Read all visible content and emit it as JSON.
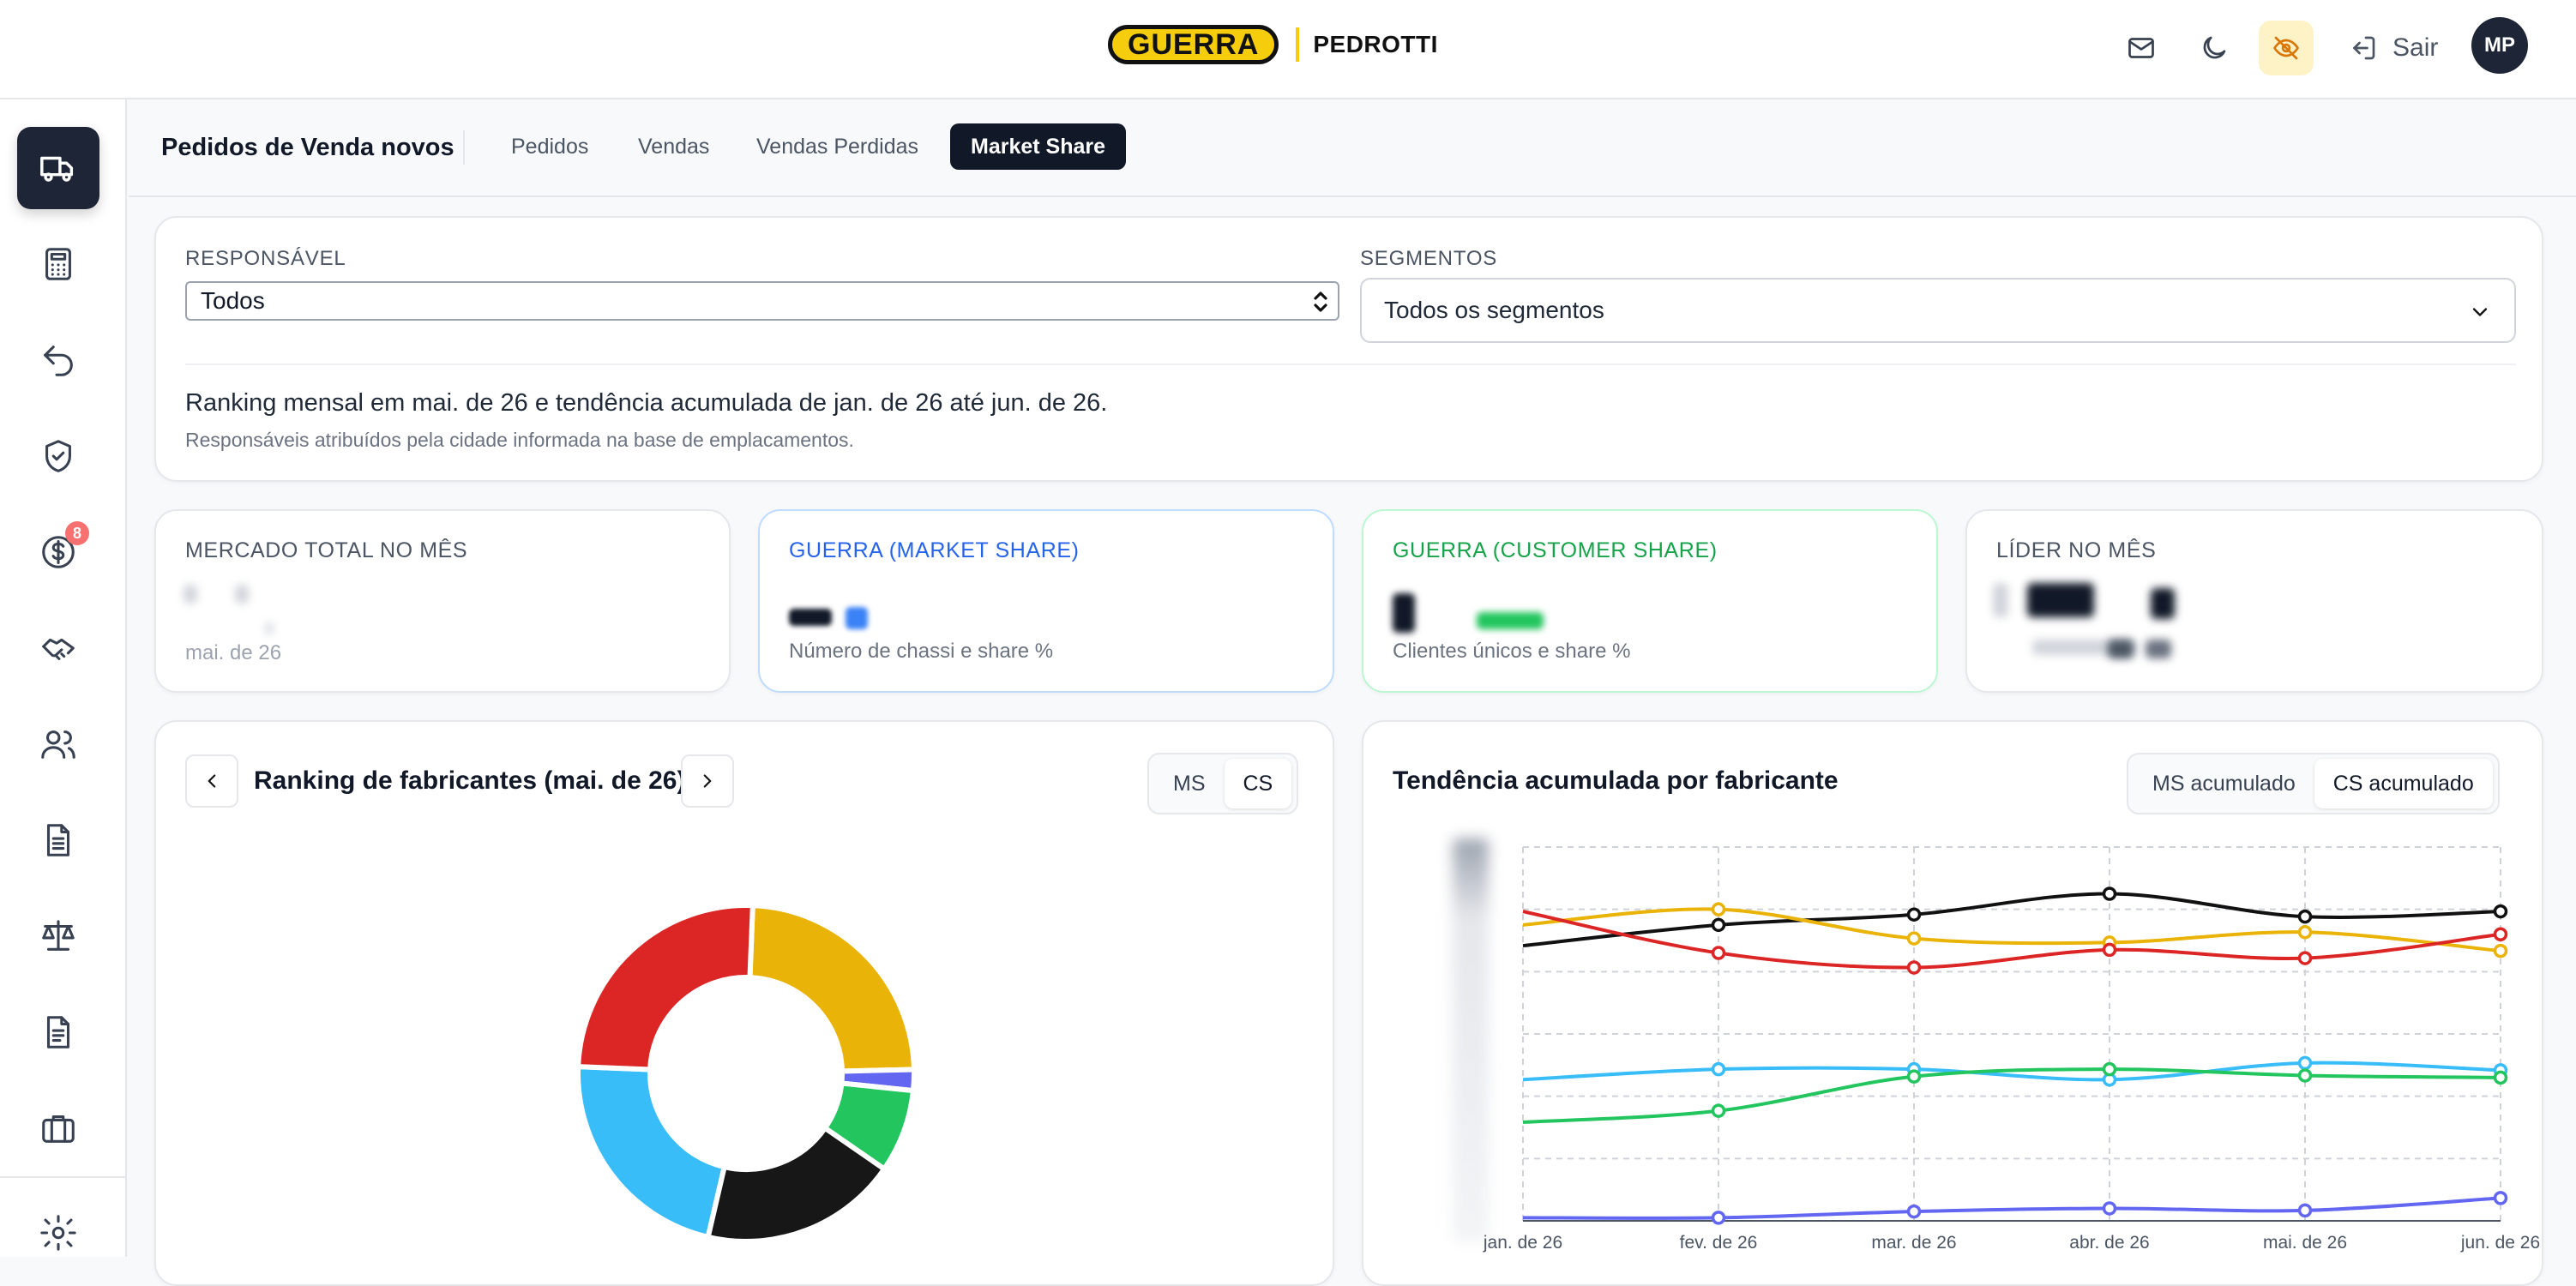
{
  "header": {
    "logo_primary": "GUERRA",
    "logo_secondary": "PEDROTTI",
    "logout_label": "Sair",
    "avatar_initials": "MP",
    "icons": [
      "mail-icon",
      "moon-icon",
      "eye-off-icon",
      "logout-icon"
    ]
  },
  "sidebar": {
    "items": [
      {
        "icon": "truck-icon",
        "active": true
      },
      {
        "icon": "calculator-icon"
      },
      {
        "icon": "undo-arrow-icon"
      },
      {
        "icon": "shield-check-icon"
      },
      {
        "icon": "dollar-circle-icon",
        "badge": "8"
      },
      {
        "icon": "handshake-icon"
      },
      {
        "icon": "users-icon"
      },
      {
        "icon": "document-icon"
      },
      {
        "icon": "scale-icon"
      },
      {
        "icon": "document-alt-icon"
      },
      {
        "icon": "briefcase-icon"
      },
      {
        "icon": "settings-icon"
      }
    ]
  },
  "subnav": {
    "title": "Pedidos de Venda novos",
    "tabs": [
      {
        "label": "Pedidos"
      },
      {
        "label": "Vendas"
      },
      {
        "label": "Vendas Perdidas"
      },
      {
        "label": "Market Share",
        "active": true
      }
    ]
  },
  "filters": {
    "responsavel_label": "RESPONSÁVEL",
    "responsavel_value": "Todos",
    "segmentos_label": "SEGMENTOS",
    "segmentos_value": "Todos os segmentos",
    "info_line": "Ranking mensal em mai. de 26 e tendência acumulada de jan. de 26 até jun. de 26.",
    "info_sub": "Responsáveis atribuídos pela cidade informada na base de emplacamentos."
  },
  "kpis": {
    "mercado_title": "MERCADO TOTAL NO MÊS",
    "mercado_sub": "mai. de 26",
    "ms_title": "GUERRA (MARKET SHARE)",
    "ms_sub": "Número de chassi e share %",
    "cs_title": "GUERRA (CUSTOMER SHARE)",
    "cs_sub": "Clientes únicos e share %",
    "lider_title": "LÍDER NO MÊS"
  },
  "colors": {
    "ms_accent": "#2563eb",
    "cs_accent": "#16a34a",
    "navy": "#1e2536"
  },
  "ranking": {
    "title": "Ranking de fabricantes (mai. de 26)",
    "toggle": [
      {
        "label": "MS"
      },
      {
        "label": "CS",
        "active": true
      }
    ],
    "chart_data": {
      "type": "pie",
      "donut": true,
      "slices": [
        {
          "color": "#eab308",
          "value": 24.0
        },
        {
          "color": "#6366f1",
          "value": 2.0
        },
        {
          "color": "#22c55e",
          "value": 8.0
        },
        {
          "color": "#171717",
          "value": 19.0
        },
        {
          "color": "#38bdf8",
          "value": 22.0
        },
        {
          "color": "#dc2626",
          "value": 25.0
        }
      ]
    }
  },
  "trend": {
    "title": "Tendência acumulada por fabricante",
    "toggle": [
      {
        "label": "MS acumulado"
      },
      {
        "label": "CS acumulado",
        "active": true
      }
    ],
    "chart_data": {
      "type": "line",
      "x": [
        "jan. de 26",
        "fev. de 26",
        "mar. de 26",
        "abr. de 26",
        "mai. de 26",
        "jun. de 26"
      ],
      "ylim": [
        0,
        36
      ],
      "grid": true,
      "series": [
        {
          "color": "#111111",
          "values": [
            26.5,
            28.5,
            29.5,
            31.5,
            29.3,
            29.8
          ]
        },
        {
          "color": "#eab308",
          "values": [
            28.5,
            30.0,
            27.2,
            26.8,
            27.8,
            26.0
          ]
        },
        {
          "color": "#dc2626",
          "values": [
            29.8,
            25.8,
            24.4,
            26.1,
            25.3,
            27.6
          ]
        },
        {
          "color": "#38bdf8",
          "values": [
            13.6,
            14.6,
            14.6,
            13.6,
            15.2,
            14.5
          ]
        },
        {
          "color": "#22c55e",
          "values": [
            9.5,
            10.6,
            13.9,
            14.6,
            14.0,
            13.8
          ]
        },
        {
          "color": "#6366f1",
          "values": [
            0.3,
            0.3,
            0.9,
            1.2,
            1.0,
            2.2
          ]
        }
      ]
    }
  }
}
